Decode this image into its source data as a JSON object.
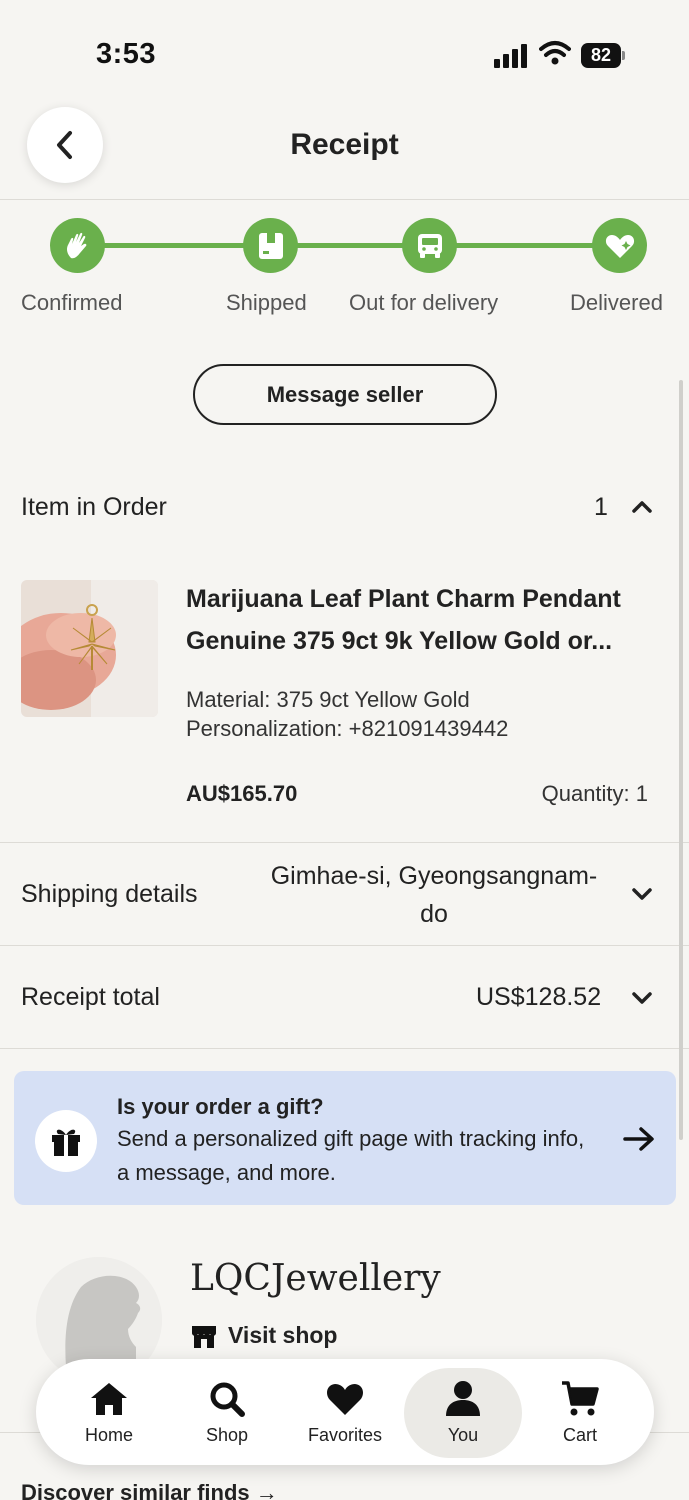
{
  "status_bar": {
    "time": "3:53",
    "battery": "82"
  },
  "header": {
    "title": "Receipt"
  },
  "tracker": {
    "accent_color": "#6ab04c",
    "steps": [
      {
        "label": "Confirmed",
        "icon": "hand-wave-icon"
      },
      {
        "label": "Shipped",
        "icon": "package-icon"
      },
      {
        "label": "Out for delivery",
        "icon": "truck-icon"
      },
      {
        "label": "Delivered",
        "icon": "heart-sparkle-icon"
      }
    ]
  },
  "actions": {
    "message_seller": "Message seller"
  },
  "order": {
    "section_label": "Item in Order",
    "count": "1",
    "item": {
      "title": "Marijuana Leaf Plant Charm Pendant Genuine 375 9ct 9k Yellow Gold or...",
      "material": "Material: 375 9ct Yellow Gold",
      "personalization": "Personalization: +821091439442",
      "price": "AU$165.70",
      "quantity": "Quantity: 1"
    }
  },
  "shipping": {
    "label": "Shipping details",
    "address": "Gimhae-si, Gyeongsangnam-do"
  },
  "receipt_total": {
    "label": "Receipt total",
    "amount": "US$128.52"
  },
  "gift": {
    "title": "Is your order a gift?",
    "description": "Send a personalized gift page with tracking info, a message, and more.",
    "background": "#d6e0f5"
  },
  "shop": {
    "name": "LQCJewellery",
    "visit": "Visit shop"
  },
  "discover": "Discover similar finds →",
  "tabbar": {
    "items": [
      {
        "label": "Home",
        "icon": "home-icon"
      },
      {
        "label": "Shop",
        "icon": "search-icon"
      },
      {
        "label": "Favorites",
        "icon": "heart-icon"
      },
      {
        "label": "You",
        "icon": "person-icon",
        "active": true
      },
      {
        "label": "Cart",
        "icon": "cart-icon"
      }
    ]
  }
}
